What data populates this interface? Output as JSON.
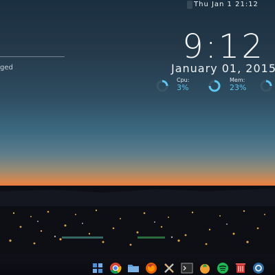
{
  "topbar": {
    "datetime": "Thu Jan  1 21:12"
  },
  "clock": {
    "time": "9:12",
    "date": "January 01, 2015"
  },
  "widgets": {
    "cpu": {
      "label": "Cpu:",
      "value": "3%",
      "fraction": 0.03
    },
    "mem": {
      "label": "Mem:",
      "value": "23%",
      "fraction": 0.23
    }
  },
  "left_widget": {
    "text": "ged"
  },
  "dock": {
    "items": [
      "grid-icon",
      "chrome-icon",
      "folder-icon",
      "firefox-icon",
      "tools-icon",
      "terminal-icon",
      "vlc-icon",
      "spotify-icon",
      "trash-icon",
      "settings-icon"
    ]
  },
  "colors": {
    "accent": "#5cc5f1",
    "text": "#f6f7f8"
  }
}
